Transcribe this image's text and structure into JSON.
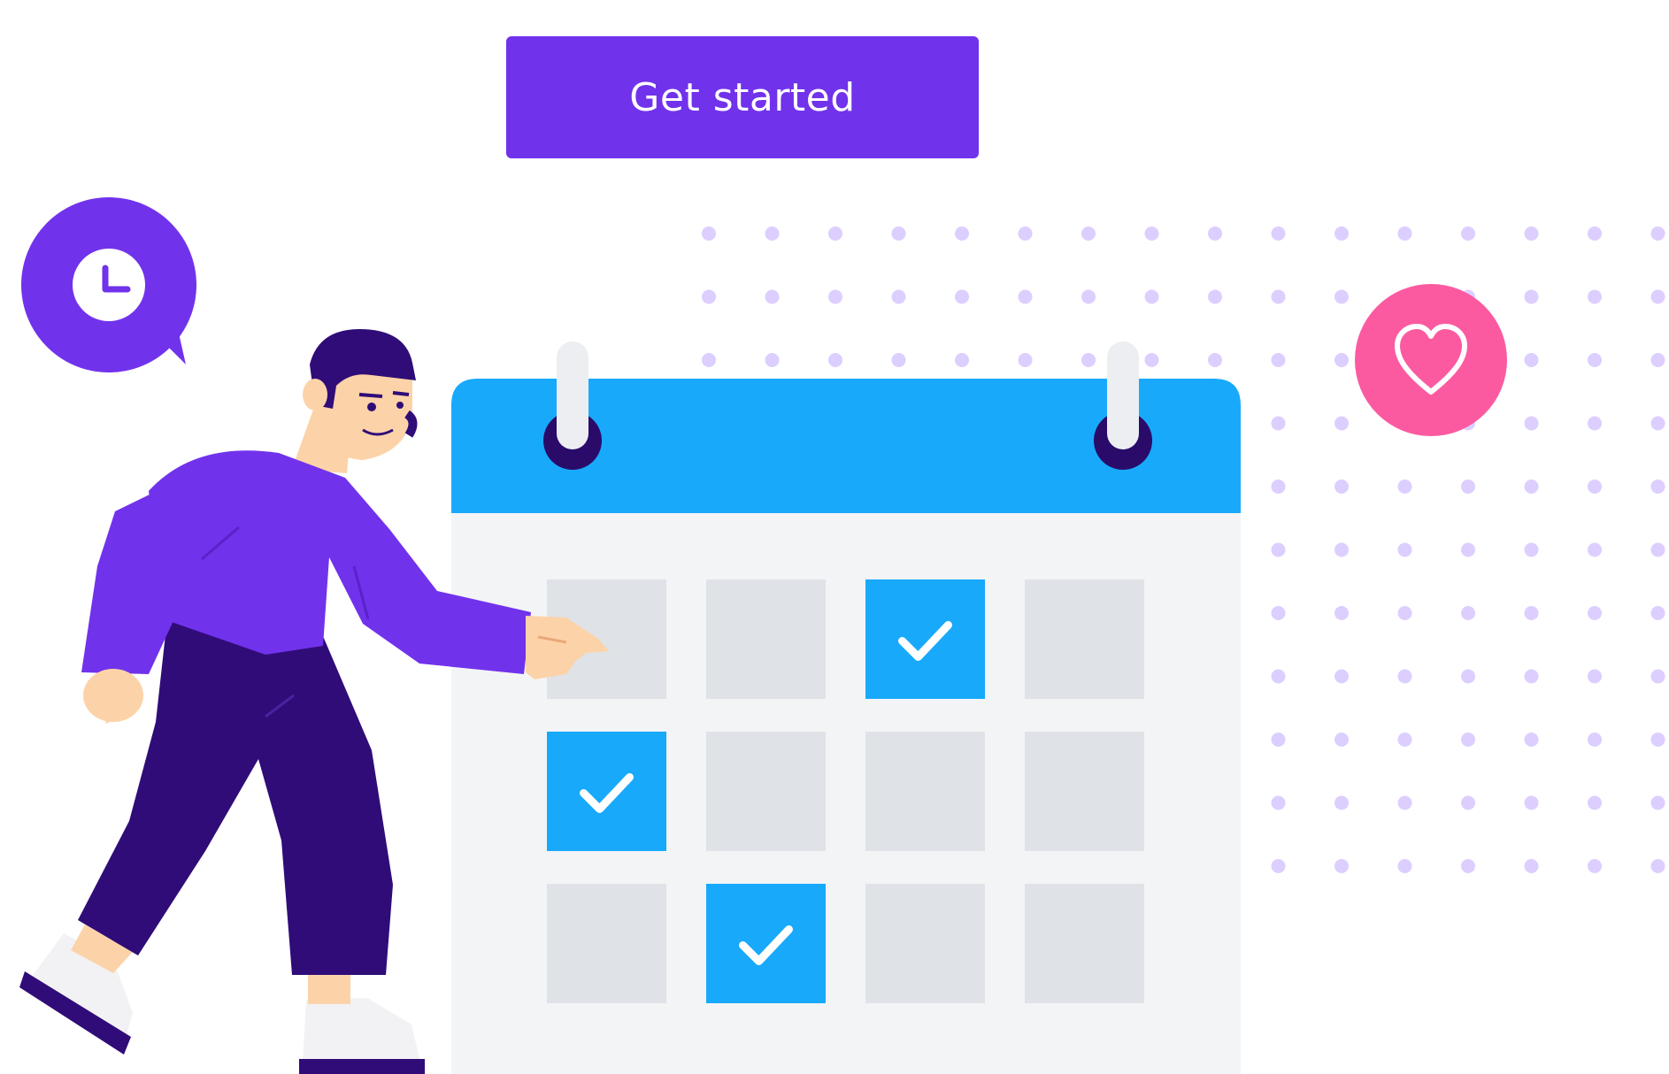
{
  "cta": {
    "label": "Get started"
  },
  "calendar": {
    "rows": 3,
    "columns": 4,
    "checked_cells": [
      [
        0,
        2
      ],
      [
        1,
        0
      ],
      [
        2,
        1
      ]
    ]
  },
  "icons": {
    "clock_bubble": "clock-icon",
    "favorite": "heart-icon",
    "cell_check": "checkmark-icon"
  },
  "colors": {
    "primary": "#7132ec",
    "calendar_header": "#18a9fb",
    "calendar_body": "#f3f4f6",
    "cell": "#dfe2e6",
    "cell_checked": "#18a9fb",
    "heart_badge": "#fb5aa1",
    "dots": "#dccfff",
    "pants": "#300c78",
    "skin": "#fcd3a8"
  }
}
